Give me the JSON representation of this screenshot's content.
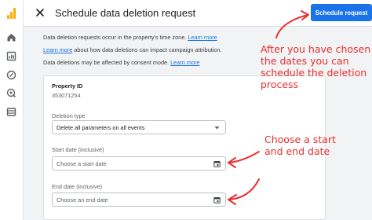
{
  "dialog": {
    "title": "Schedule data deletion request",
    "submit_label": "Schedule request"
  },
  "info": {
    "line1_text": "Data deletion requests occur in the property's time zone.",
    "line1_link": "Learn more",
    "line2_link": "Learn more",
    "line2_text": "about how data deletions can impact campaign attribution.",
    "line3_text": "Data deletions may be affected by consent mode.",
    "line3_link": "Learn more"
  },
  "form": {
    "property_label": "Property ID",
    "property_value": "353071254",
    "deletion_type_label": "Deletion type",
    "deletion_type_value": "Delete all parameters on all events",
    "start_label": "Start date (inclusive)",
    "start_placeholder": "Choose a start date",
    "end_label": "End date (inclusive)",
    "end_placeholder": "Choose an end date"
  },
  "annotations": {
    "top": [
      "After you have chosen",
      "the dates you can",
      "schedule the deletion",
      "process"
    ],
    "mid": [
      "Choose a start",
      "and end date"
    ]
  },
  "colors": {
    "accent": "#1a73e8",
    "annotation": "#e8302f",
    "logo": "#f9ab00"
  },
  "icons": {
    "close": "close-icon",
    "dropdown": "chevron-down-icon",
    "calendar": "calendar-icon"
  }
}
